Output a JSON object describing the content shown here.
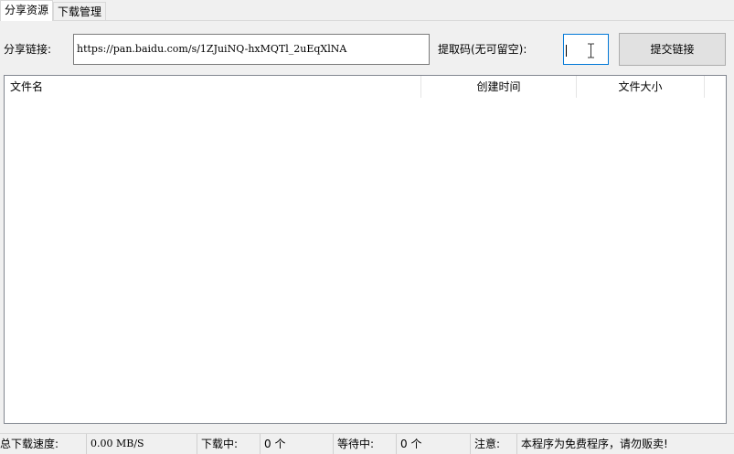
{
  "tabs": [
    {
      "label": "分享资源",
      "active": true
    },
    {
      "label": "下载管理",
      "active": false
    }
  ],
  "share_link": {
    "label": "分享链接:",
    "value": "https://pan.baidu.com/s/1ZJuiNQ-hxMQTl_2uEqXlNA"
  },
  "extract_code": {
    "label": "提取码(无可留空):",
    "value": ""
  },
  "submit_button": {
    "label": "提交链接"
  },
  "file_list": {
    "columns": [
      "文件名",
      "创建时间",
      "文件大小"
    ],
    "rows": []
  },
  "status_bar": {
    "total_speed_label": "总下载速度:",
    "total_speed_value": "0.00 MB/S",
    "downloading_label": "下载中:",
    "downloading_value": "0 个",
    "waiting_label": "等待中:",
    "waiting_value": "0 个",
    "notice_label": "注意:",
    "notice_value": "本程序为免费程序，请勿贩卖!"
  },
  "colors": {
    "window_bg": "#f0f0f0",
    "focus_border": "#0078d7",
    "button_bg": "#e1e1e1"
  }
}
